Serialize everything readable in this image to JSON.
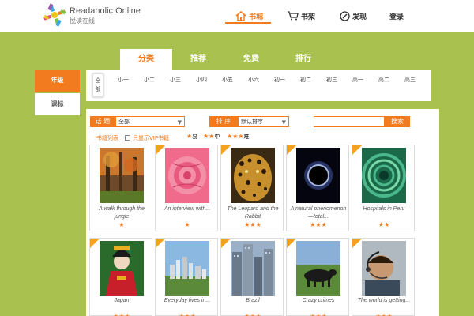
{
  "header": {
    "brand_en": "Readaholic Online",
    "brand_cn": "悦读在线",
    "nav": [
      {
        "label": "书城",
        "icon": "home-icon",
        "active": true
      },
      {
        "label": "书架",
        "icon": "cart-icon",
        "active": false
      },
      {
        "label": "发现",
        "icon": "compass-icon",
        "active": false
      },
      {
        "label": "登录",
        "icon": "",
        "active": false
      }
    ]
  },
  "top_tabs": [
    "分类",
    "推荐",
    "免费",
    "排行"
  ],
  "left_tabs": [
    "年级",
    "课标"
  ],
  "grades": [
    "全部",
    "小一",
    "小二",
    "小三",
    "小四",
    "小五",
    "小六",
    "初一",
    "初二",
    "初三",
    "高一",
    "高二",
    "高三"
  ],
  "filters": {
    "topic_label": "话 题",
    "topic_value": "全部",
    "sort_label": "排 序",
    "sort_value": "默认排序",
    "search_placeholder": "",
    "search_button": "搜索",
    "book_list_link": "书籍列表",
    "vip_only": "只显示VIP书籍",
    "difficulty": [
      {
        "stars": "★",
        "label": "易"
      },
      {
        "stars": "★★",
        "label": "中"
      },
      {
        "stars": "★★★",
        "label": "难"
      }
    ]
  },
  "books": [
    {
      "title": "A walk through the jungle",
      "rating": "★",
      "vip": false,
      "cover": "forest"
    },
    {
      "title": "An interview with...",
      "rating": "★",
      "vip": true,
      "cover": "rose"
    },
    {
      "title": "The Leopard and the Rabbit",
      "rating": "★★★",
      "vip": true,
      "cover": "leopard"
    },
    {
      "title": "A natural phenomenon—total...",
      "rating": "★★★",
      "vip": true,
      "cover": "eclipse"
    },
    {
      "title": "Hospitals in Peru",
      "rating": "★★",
      "vip": true,
      "cover": "spiral"
    },
    {
      "title": "Japan",
      "rating": "★★★",
      "vip": true,
      "cover": "japan"
    },
    {
      "title": "Everyday lives in...",
      "rating": "★★★",
      "vip": true,
      "cover": "city"
    },
    {
      "title": "Brazil",
      "rating": "★★★",
      "vip": true,
      "cover": "skyscraper"
    },
    {
      "title": "Crazy crimes",
      "rating": "★★★",
      "vip": true,
      "cover": "cow"
    },
    {
      "title": "The world is getting...",
      "rating": "★★★",
      "vip": true,
      "cover": "headset"
    }
  ],
  "colors": {
    "accent": "#f27b1f",
    "background": "#a9c14f"
  }
}
